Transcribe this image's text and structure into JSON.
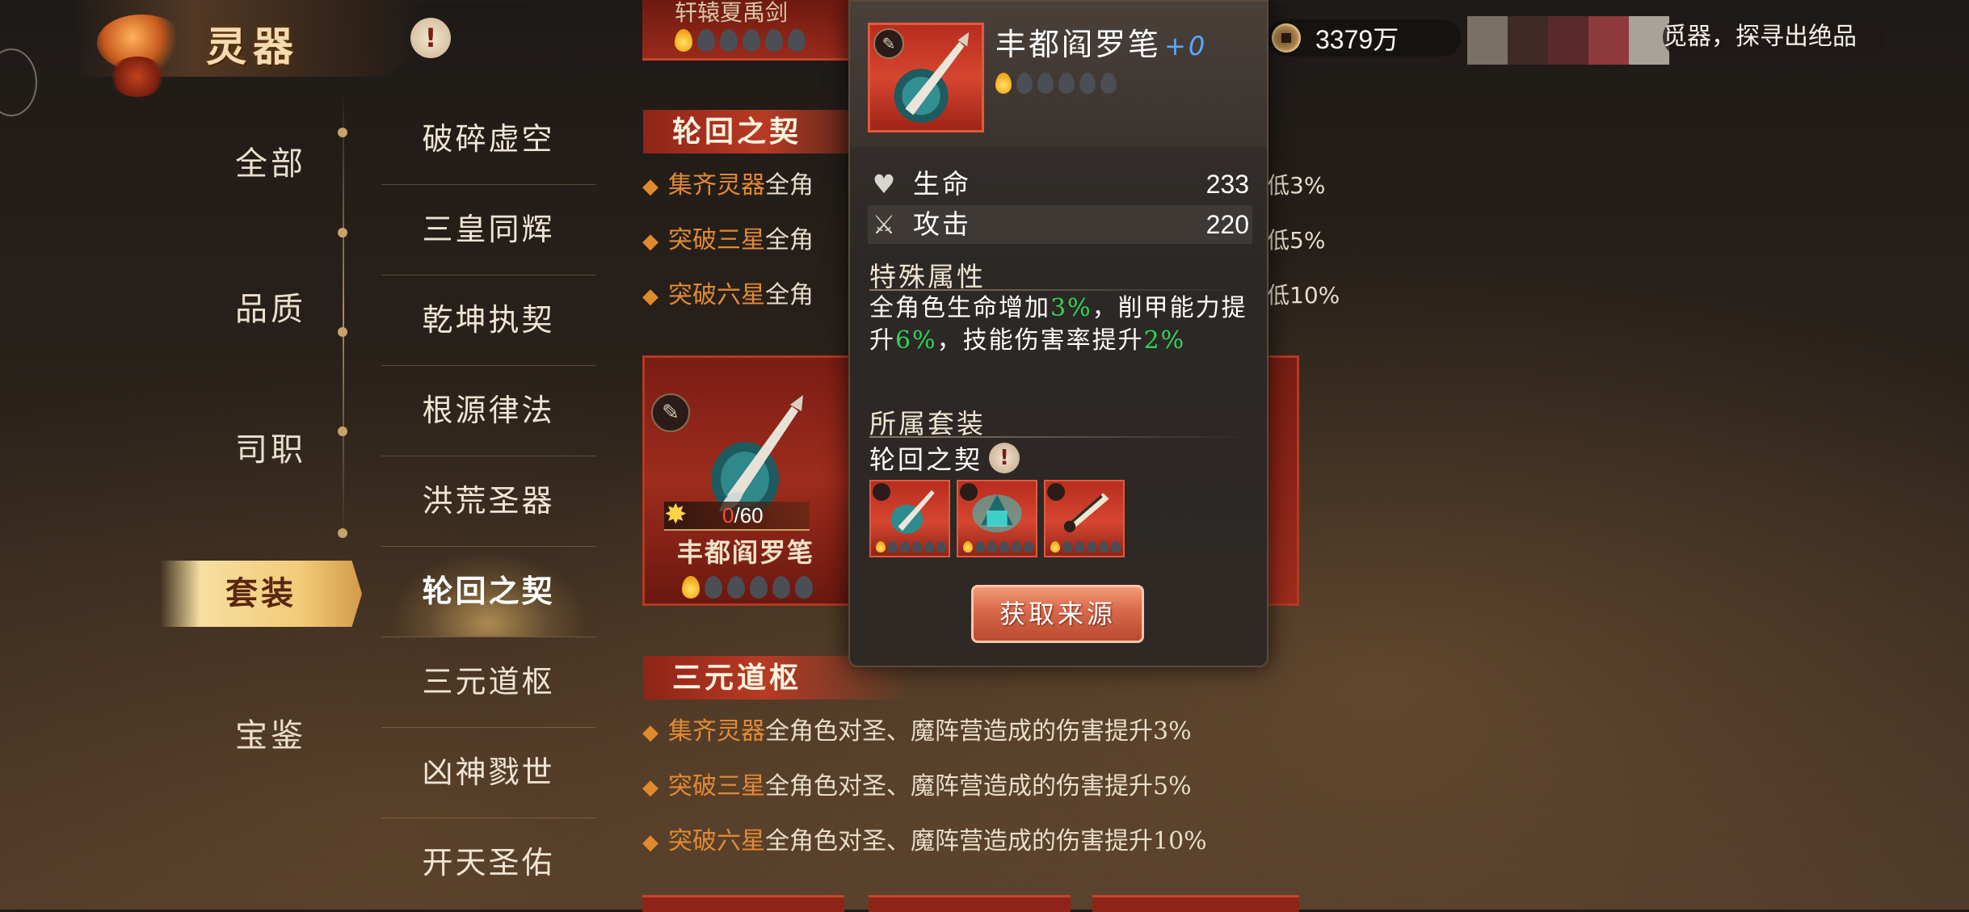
{
  "header": {
    "title": "灵器",
    "info_glyph": "!",
    "currency": {
      "icon": "coin-icon",
      "value": "3379万"
    },
    "ticker_text": "觅器，探寻出绝品",
    "swatch_colors": [
      "#7a7065",
      "#3f2a28",
      "#5a2a2b",
      "#8e3a3c",
      "#a8a29a"
    ]
  },
  "nav": {
    "items": [
      {
        "label": "全部"
      },
      {
        "label": "品质"
      },
      {
        "label": "司职"
      },
      {
        "label": "套装",
        "active": true
      },
      {
        "label": "宝鉴"
      }
    ]
  },
  "sublist": {
    "items": [
      {
        "label": "破碎虚空"
      },
      {
        "label": "三皇同辉"
      },
      {
        "label": "乾坤执契"
      },
      {
        "label": "根源律法"
      },
      {
        "label": "洪荒圣器"
      },
      {
        "label": "轮回之契",
        "active": true
      },
      {
        "label": "三元道枢"
      },
      {
        "label": "凶神戮世"
      },
      {
        "label": "开天圣佑"
      }
    ]
  },
  "content": {
    "top_card_name": "轩辕夏禹剑",
    "sections": [
      {
        "title": "轮回之契",
        "bonuses": [
          {
            "bullet": "◆",
            "cond": "集齐灵器",
            "text": "全角",
            "tail": "低3%"
          },
          {
            "bullet": "◆",
            "cond": "突破三星",
            "text": "全角",
            "tail": "低5%"
          },
          {
            "bullet": "◆",
            "cond": "突破六星",
            "text": "全角",
            "tail": "低10%"
          }
        ],
        "card": {
          "name": "丰都阎罗笔",
          "fragments_current": "0",
          "fragments_total": "/60",
          "type_glyph": "✎",
          "fragment_glyph": "✸"
        }
      },
      {
        "title": "三元道枢",
        "bonuses": [
          {
            "bullet": "◆",
            "cond": "突破六星",
            "text": "全角色对圣、魔阵营造成的伤害提升10%"
          },
          {
            "bullet": "◆",
            "cond": "突破三星",
            "text": "全角色对圣、魔阵营造成的伤害提升5%"
          },
          {
            "bullet": "◆",
            "cond": "集齐灵器",
            "text": "全角色对圣、魔阵营造成的伤害提升3%"
          }
        ]
      }
    ]
  },
  "popup": {
    "name": "丰都阎罗笔",
    "plus": "+0",
    "stars_lit": 1,
    "stars_total": 6,
    "stats": [
      {
        "icon": "heart-icon",
        "glyph": "♥",
        "label": "生命",
        "value": "233"
      },
      {
        "icon": "sword-icon",
        "glyph": "⚔",
        "label": "攻击",
        "value": "220"
      }
    ],
    "special_title": "特殊属性",
    "special_desc": {
      "p1": "全角色生命增加",
      "v1": "3%",
      "p2": "，削甲能力提升",
      "v2": "6%",
      "p3": "，技能伤害率提升",
      "v3": "2%"
    },
    "set_title": "所属套装",
    "set_name": "轮回之契",
    "set_info_glyph": "!",
    "obtain_label": "获取来源"
  }
}
